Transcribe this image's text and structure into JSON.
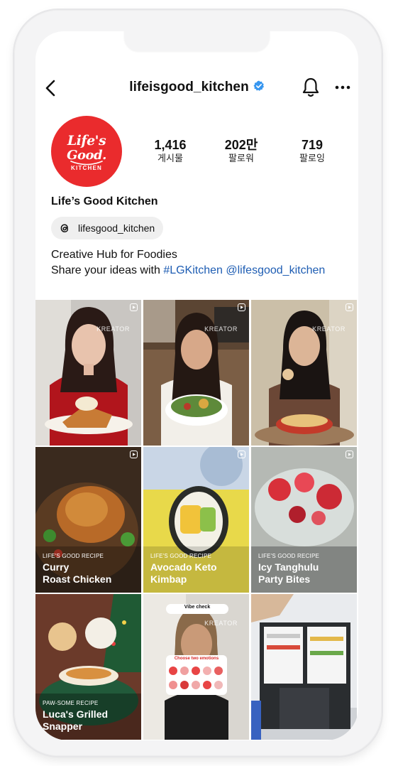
{
  "header": {
    "username": "lifeisgood_kitchen"
  },
  "profile": {
    "avatar_logo": {
      "line1": "Life's",
      "line2": "Good.",
      "sub": "KITCHEN"
    },
    "stats": [
      {
        "value": "1,416",
        "label": "게시물"
      },
      {
        "value": "202만",
        "label": "팔로워"
      },
      {
        "value": "719",
        "label": "팔로잉"
      }
    ],
    "display_name": "Life’s Good Kitchen",
    "threads_handle": "lifesgood_kitchen",
    "bio_line1": "Creative Hub for Foodies",
    "bio_line2_prefix": "Share your ideas with ",
    "bio_hashtag": "#LGKitchen",
    "bio_mention": "@lifesgood_kitchen"
  },
  "grid": {
    "creator_label": "KREATOR",
    "tiles": [
      {
        "kicker": "",
        "title1": "",
        "title2": ""
      },
      {
        "kicker": "",
        "title1": "",
        "title2": ""
      },
      {
        "kicker": "",
        "title1": "",
        "title2": ""
      },
      {
        "kicker": "LIFE'S GOOD RECIPE",
        "title1": "Curry",
        "title2": "Roast Chicken"
      },
      {
        "kicker": "LIFE'S GOOD RECIPE",
        "title1": "Avocado Keto",
        "title2": "Kimbap"
      },
      {
        "kicker": "LIFE'S GOOD RECIPE",
        "title1": "Icy Tanghulu",
        "title2": "Party Bites"
      },
      {
        "kicker": "PAW-SOME RECIPE",
        "title1": "Luca's Grilled",
        "title2": "Snapper"
      },
      {
        "kicker": "",
        "title1": "Vibe check",
        "title2": "Choose two emotions"
      },
      {
        "kicker": "",
        "title1": "",
        "title2": ""
      }
    ]
  },
  "colors": {
    "brand_red": "#ea2b2d",
    "link_blue": "#1e5db3",
    "verified_blue": "#3897f0"
  }
}
